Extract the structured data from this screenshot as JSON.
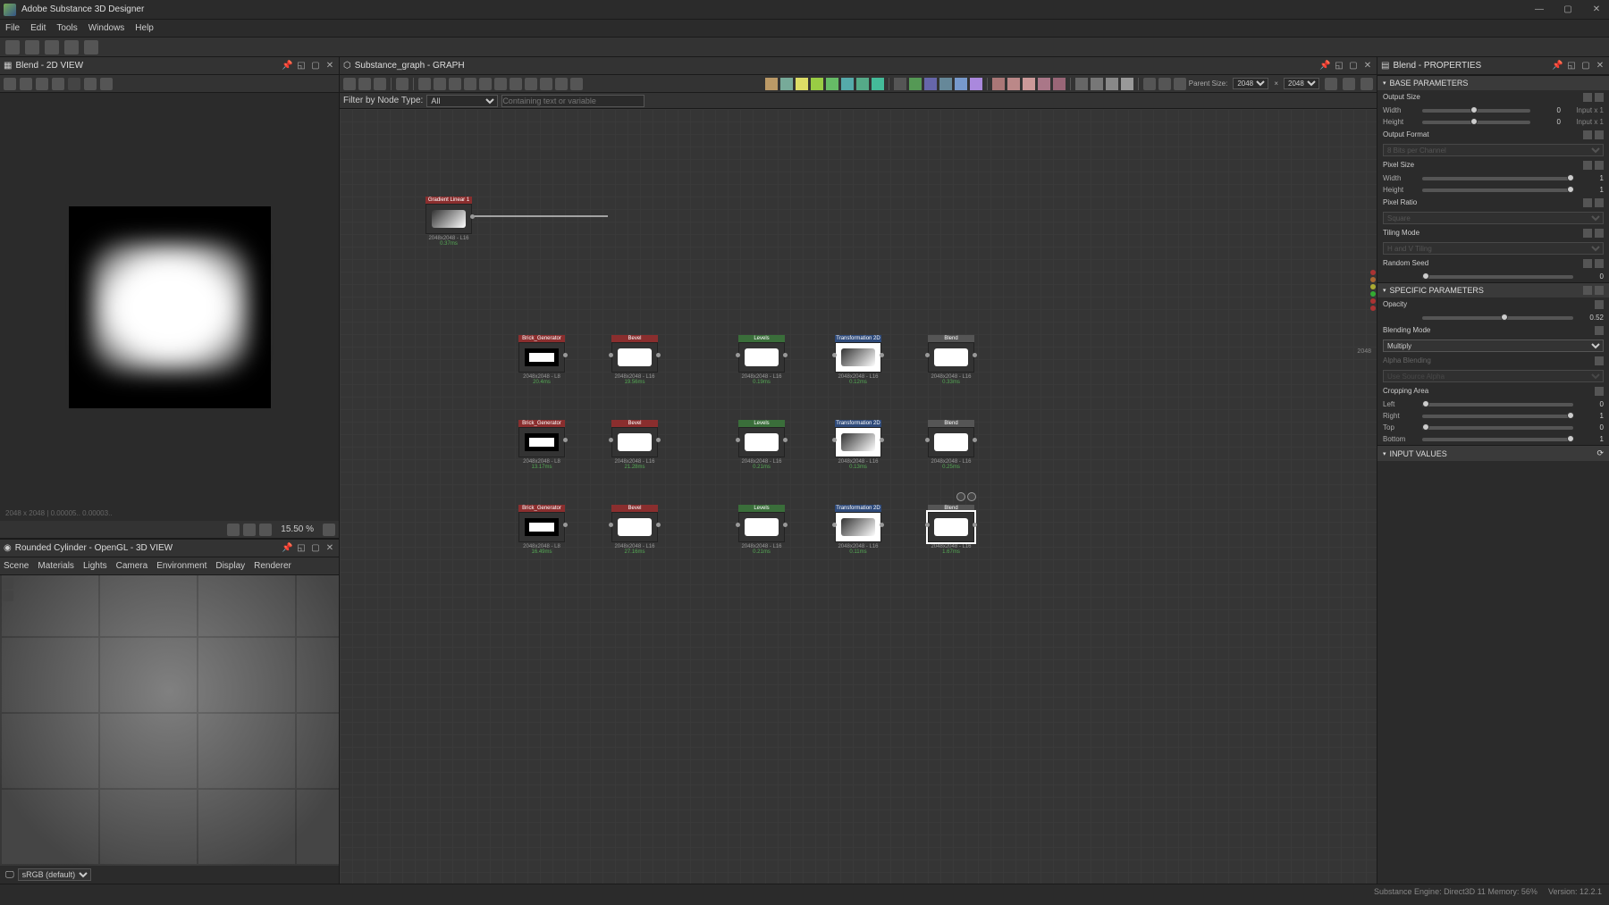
{
  "app": {
    "title": "Adobe Substance 3D Designer"
  },
  "menubar": [
    "File",
    "Edit",
    "Tools",
    "Windows",
    "Help"
  ],
  "panel2d": {
    "title": "Blend - 2D VIEW",
    "zoom": "15.50 %",
    "coord": "2048 x 2048 | 0.00005.. 0.00003.."
  },
  "panel3d": {
    "title": "Rounded Cylinder - OpenGL - 3D VIEW",
    "menu": [
      "Scene",
      "Materials",
      "Lights",
      "Camera",
      "Environment",
      "Display",
      "Renderer"
    ],
    "color_profile": "sRGB (default)"
  },
  "graph": {
    "title": "Substance_graph - GRAPH",
    "filter_label": "Filter by Node Type:",
    "filter_type": "All",
    "filter_var_placeholder": "Containing text or variable",
    "parent_size_label": "Parent Size:",
    "parent_w": "2048",
    "parent_h": "2048",
    "output_dim_label": "2048"
  },
  "nodes": {
    "gradient": {
      "name": "Gradient Linear 1",
      "info": "2048x2048 - L16",
      "time": "0.37ms"
    },
    "brick1": {
      "name": "Brick_Generator",
      "info": "2048x2048 - L8",
      "time": "20.4ms"
    },
    "bevel1": {
      "name": "Bevel",
      "info": "2048x2048 - L16",
      "time": "19.56ms"
    },
    "levels1": {
      "name": "Levels",
      "info": "2048x2048 - L16",
      "time": "0.19ms"
    },
    "trans1": {
      "name": "Transformation 2D",
      "info": "2048x2048 - L16",
      "time": "0.12ms"
    },
    "blend1": {
      "name": "Blend",
      "info": "2048x2048 - L16",
      "time": "0.33ms"
    },
    "brick2": {
      "name": "Brick_Generator",
      "info": "2048x2048 - L8",
      "time": "13.17ms"
    },
    "bevel2": {
      "name": "Bevel",
      "info": "2048x2048 - L16",
      "time": "21.28ms"
    },
    "levels2": {
      "name": "Levels",
      "info": "2048x2048 - L16",
      "time": "0.21ms"
    },
    "trans2": {
      "name": "Transformation 2D",
      "info": "2048x2048 - L16",
      "time": "0.13ms"
    },
    "blend2": {
      "name": "Blend",
      "info": "2048x2048 - L16",
      "time": "0.25ms"
    },
    "brick3": {
      "name": "Brick_Generator",
      "info": "2048x2048 - L8",
      "time": "16.49ms"
    },
    "bevel3": {
      "name": "Bevel",
      "info": "2048x2048 - L16",
      "time": "27.16ms"
    },
    "levels3": {
      "name": "Levels",
      "info": "2048x2048 - L16",
      "time": "0.21ms"
    },
    "trans3": {
      "name": "Transformation 2D",
      "info": "2048x2048 - L16",
      "time": "0.11ms"
    },
    "blend3": {
      "name": "Blend",
      "info": "2048x2048 - L16",
      "time": "1.67ms"
    }
  },
  "props": {
    "title": "Blend - PROPERTIES",
    "base_params": "BASE PARAMETERS",
    "output_size": "Output Size",
    "width": "Width",
    "height": "Height",
    "size_val": "0",
    "size_extra": "Input x 1",
    "output_format": "Output Format",
    "format_val": "8 Bits per Channel",
    "pixel_size": "Pixel Size",
    "pixel_val": "1",
    "pixel_ratio": "Pixel Ratio",
    "ratio_val": "Square",
    "tiling_mode": "Tiling Mode",
    "tiling_val": "H and V Tiling",
    "random_seed": "Random Seed",
    "seed_val": "0",
    "specific_params": "SPECIFIC PARAMETERS",
    "opacity": "Opacity",
    "opacity_val": "0.52",
    "blending_mode": "Blending Mode",
    "blend_val": "Multiply",
    "alpha_blending": "Alpha Blending",
    "alpha_val": "Use Source Alpha",
    "cropping_area": "Cropping Area",
    "left": "Left",
    "left_val": "0",
    "right": "Right",
    "right_val": "1",
    "top": "Top",
    "top_val": "0",
    "bottom": "Bottom",
    "bottom_val": "1",
    "input_values": "INPUT VALUES"
  },
  "status": {
    "engine": "Substance Engine: Direct3D 11  Memory: 56%",
    "version": "Version: 12.2.1"
  }
}
